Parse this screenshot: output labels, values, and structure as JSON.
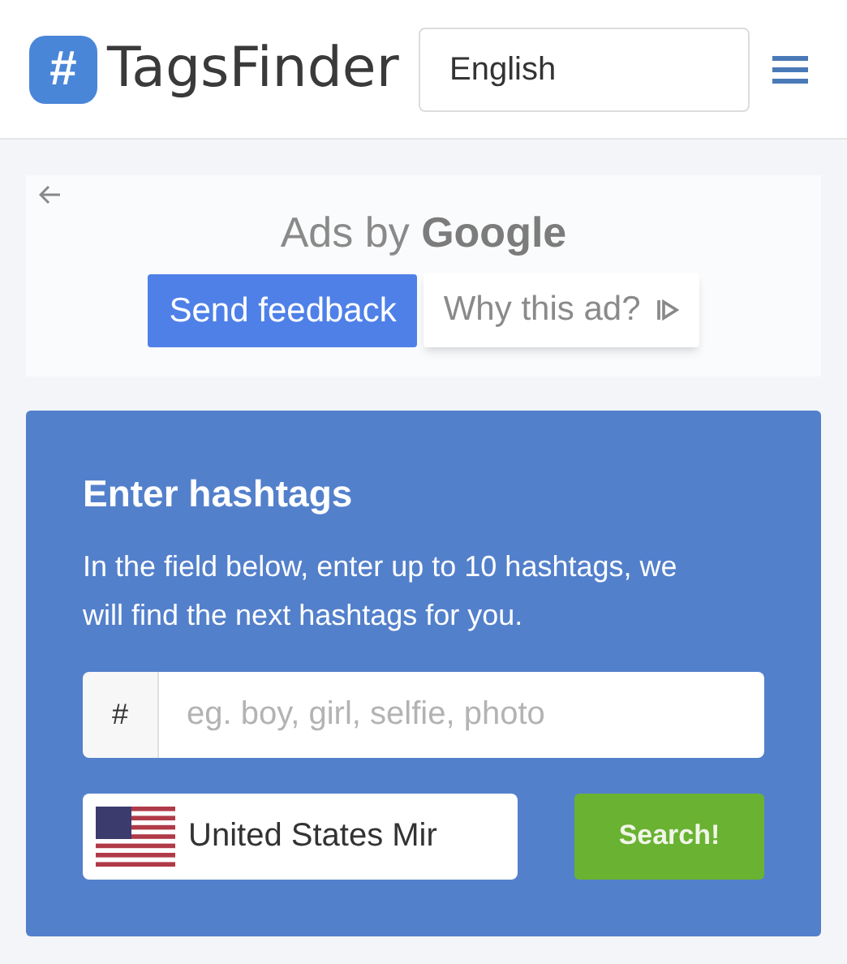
{
  "header": {
    "logo_mark": "#",
    "logo_text": "TagsFinder",
    "language": "English"
  },
  "ad": {
    "title_prefix": "Ads by",
    "title_brand": "Google",
    "buttons": [
      {
        "label": "Send feedback",
        "kind": "primary"
      },
      {
        "label": "Why this ad?",
        "kind": "secondary"
      }
    ]
  },
  "search_card": {
    "title": "Enter hashtags",
    "description": "In the field below, enter up to 10 hashtags, we will find the next hashtags for you.",
    "prefix": "#",
    "placeholder": "eg. boy, girl, selfie, photo",
    "country": "United States Mir",
    "button": "Search!"
  }
}
